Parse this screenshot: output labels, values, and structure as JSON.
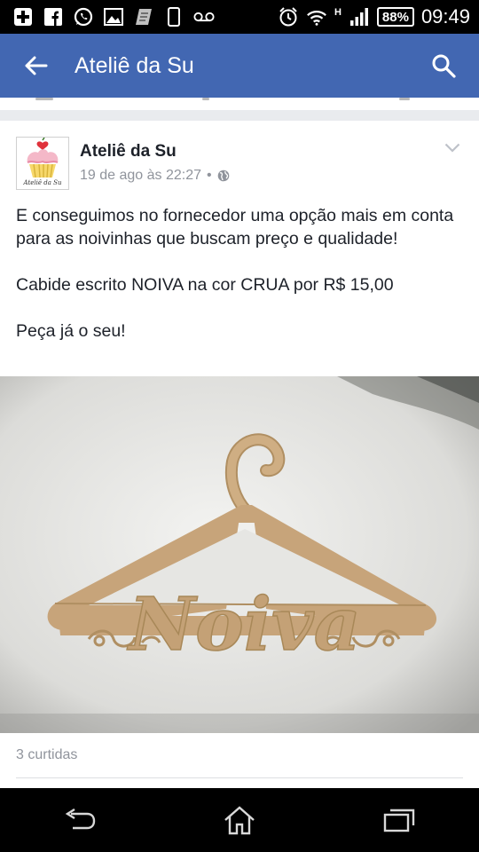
{
  "status_bar": {
    "battery": "88%",
    "time": "09:49",
    "network": "H"
  },
  "app_bar": {
    "title": "Ateliê da Su"
  },
  "post": {
    "author": "Ateliê da Su",
    "timestamp": "19 de ago às 22:27",
    "separator": "•",
    "avatar_caption": "Ateliê da Su",
    "paragraphs": [
      "E conseguimos no fornecedor uma opção mais em conta para as noivinhas que buscam preço e qualidade!",
      "Cabide escrito NOIVA na cor CRUA por R$ 15,00",
      "Peça já o seu!"
    ],
    "image_text": "Noiva",
    "likes": "3 curtidas"
  },
  "colors": {
    "brand": "#4267b2",
    "text": "#1d2129",
    "muted": "#90949c",
    "hanger": "#c8a67c"
  },
  "icons": {
    "status_left": [
      "plus-icon",
      "facebook-icon",
      "whatsapp-icon",
      "gallery-icon",
      "sim-icon",
      "phone-icon",
      "voicemail-icon"
    ],
    "status_right": [
      "alarm-icon",
      "wifi-icon",
      "signal-icon",
      "battery-icon"
    ],
    "app_bar": [
      "back-arrow-icon",
      "search-icon"
    ],
    "post": [
      "globe-icon",
      "chevron-down-icon"
    ],
    "nav_bar": [
      "back-icon",
      "home-icon",
      "recent-apps-icon"
    ]
  }
}
